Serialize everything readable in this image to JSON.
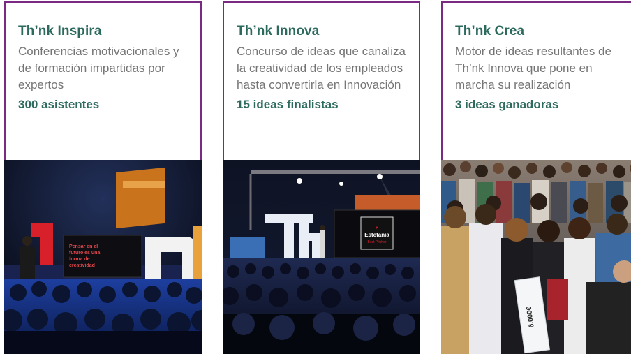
{
  "cards": [
    {
      "title": "Th’nk Inspira",
      "description": "Conferencias motivacionales y de formación impartidas por expertos",
      "stat": "300 asistentes",
      "screen_text": "Pensar en el futuro es una forma de creatividad",
      "photo_alt": "speaker-on-stage"
    },
    {
      "title": "Th’nk Innova",
      "description": "Concurso de ideas que canaliza la creatividad de los empleados hasta convertirla en Innovación",
      "stat": "15 ideas finalistas",
      "screen_text": "Estefanía",
      "screen_sub": "Best Pitcher",
      "photo_alt": "audience-and-stage"
    },
    {
      "title": "Th’nk Crea",
      "description": "Motor de ideas resultantes de Th’nk Innova que pone en marcha su realización",
      "stat": "3 ideas ganadoras",
      "cheque_text": "6.000€",
      "photo_alt": "winners-crowd"
    }
  ],
  "colors": {
    "border": "#7a2a82",
    "title": "#2c6a5e",
    "text": "#757575"
  }
}
